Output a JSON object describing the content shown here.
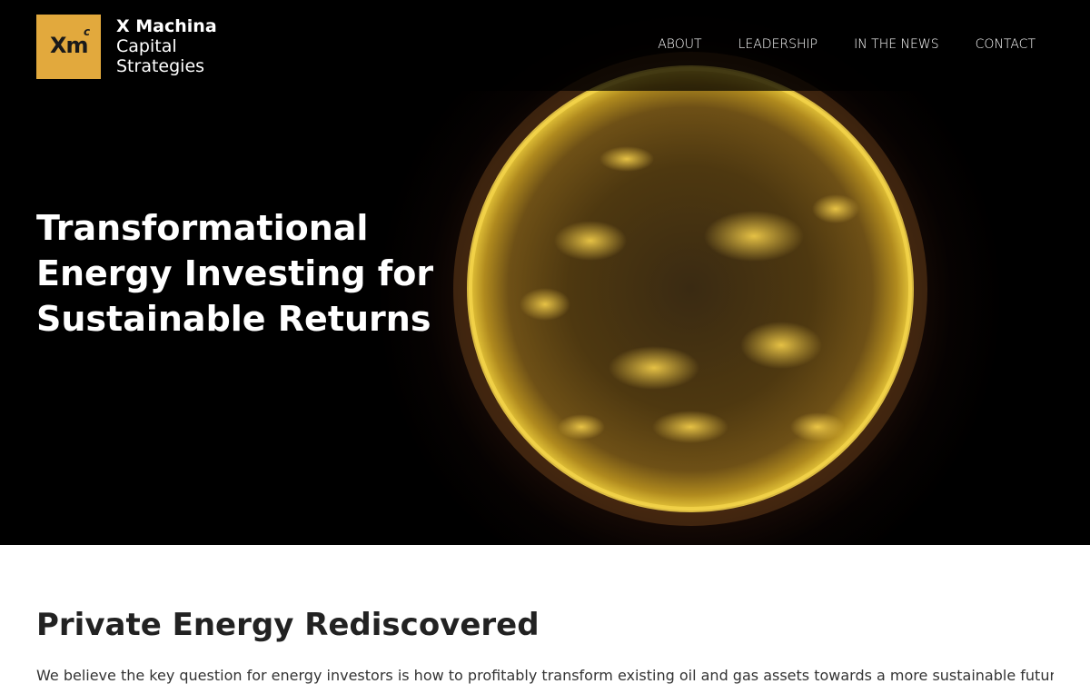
{
  "brand": {
    "logo_mark": "Xm",
    "logo_superscript": "c",
    "name_line1": "X Machina",
    "name_line2": "Capital",
    "name_line3": "Strategies",
    "accent_color": "#e2a93d"
  },
  "nav": {
    "items": [
      {
        "label": "ABOUT"
      },
      {
        "label": "LEADERSHIP"
      },
      {
        "label": "IN THE NEWS"
      },
      {
        "label": "CONTACT"
      }
    ]
  },
  "hero": {
    "title": "Transformational Energy Investing for Sustainable Returns",
    "image": "sun-image"
  },
  "section": {
    "title": "Private Energy Rediscovered",
    "body": "We believe the key question for energy investors is how to profitably transform existing oil and gas assets towards a more sustainable future. We"
  }
}
